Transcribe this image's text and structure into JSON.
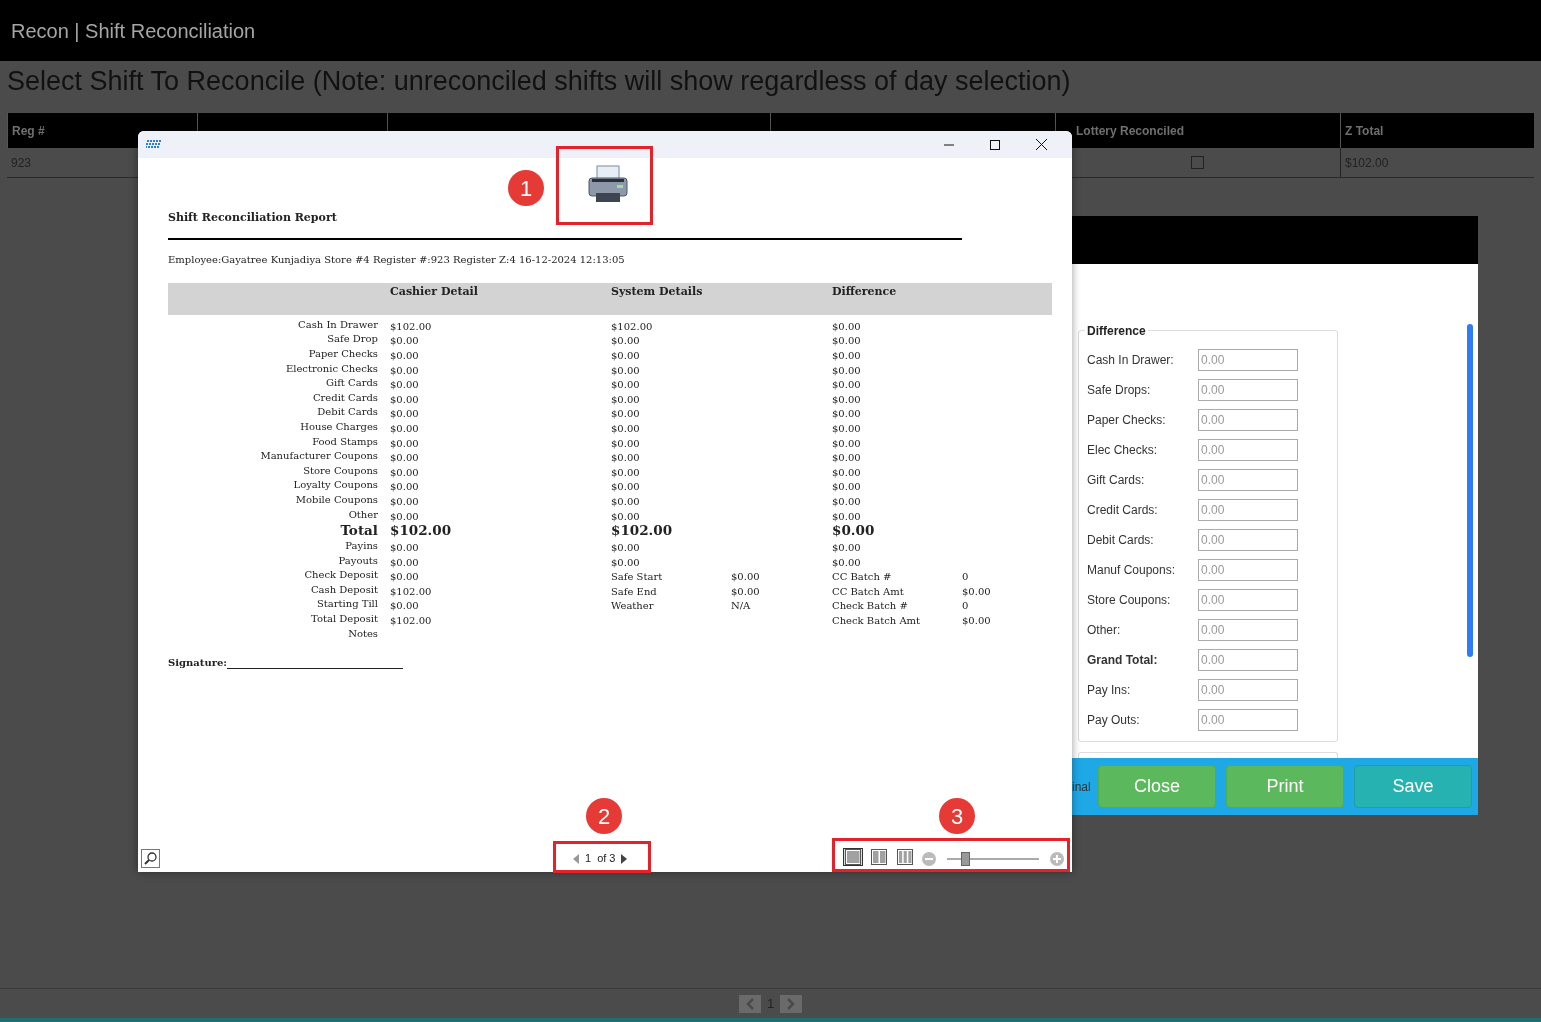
{
  "app": {
    "title": "Recon | Shift Reconciliation",
    "heading": "Select Shift To Reconcile (Note: unreconciled shifts will show regardless of day selection)"
  },
  "table": {
    "columns": [
      "Reg #",
      "Lottery Reconciled",
      "Z Total"
    ],
    "rows": [
      {
        "reg": "923",
        "lottery_reconciled": false,
        "z_total": "$102.00"
      }
    ]
  },
  "pagination": {
    "page": "1"
  },
  "edit_dialog": {
    "group_title": "Difference",
    "fields": [
      {
        "label": "Cash In Drawer:",
        "value": "0.00",
        "bold": false
      },
      {
        "label": "Safe Drops:",
        "value": "0.00",
        "bold": false
      },
      {
        "label": "Paper Checks:",
        "value": "0.00",
        "bold": false
      },
      {
        "label": "Elec Checks:",
        "value": "0.00",
        "bold": false
      },
      {
        "label": "Gift Cards:",
        "value": "0.00",
        "bold": false
      },
      {
        "label": "Credit Cards:",
        "value": "0.00",
        "bold": false
      },
      {
        "label": "Debit Cards:",
        "value": "0.00",
        "bold": false
      },
      {
        "label": "Manuf Coupons:",
        "value": "0.00",
        "bold": false
      },
      {
        "label": "Store Coupons:",
        "value": "0.00",
        "bold": false
      },
      {
        "label": "Other:",
        "value": "0.00",
        "bold": false
      },
      {
        "label": "Grand Total:",
        "value": "0.00",
        "bold": true
      },
      {
        "label": "Pay Ins:",
        "value": "0.00",
        "bold": false
      },
      {
        "label": "Pay Outs:",
        "value": "0.00",
        "bold": false
      }
    ],
    "footer_text": "inal",
    "buttons": [
      {
        "label": "Close",
        "kind": "green"
      },
      {
        "label": "Print",
        "kind": "green"
      },
      {
        "label": "Save",
        "kind": "teal"
      }
    ]
  },
  "report_window": {
    "annotations": [
      "1",
      "2",
      "3"
    ],
    "report": {
      "title": "Shift Reconciliation Report",
      "info": "Employee:Gayatree Kunjadiya Store #4 Register #:923 Register Z:4  16-12-2024 12:13:05",
      "columns": [
        "Cashier Detail",
        "System Details",
        "Difference"
      ],
      "rows": [
        {
          "label": "Cash In Drawer",
          "cashier": "$102.00",
          "system": "$102.00",
          "difference": "$0.00",
          "total": false
        },
        {
          "label": "Safe Drop",
          "cashier": "$0.00",
          "system": "$0.00",
          "difference": "$0.00",
          "total": false
        },
        {
          "label": "Paper Checks",
          "cashier": "$0.00",
          "system": "$0.00",
          "difference": "$0.00",
          "total": false
        },
        {
          "label": "Electronic Checks",
          "cashier": "$0.00",
          "system": "$0.00",
          "difference": "$0.00",
          "total": false
        },
        {
          "label": "Gift Cards",
          "cashier": "$0.00",
          "system": "$0.00",
          "difference": "$0.00",
          "total": false
        },
        {
          "label": "Credit Cards",
          "cashier": "$0.00",
          "system": "$0.00",
          "difference": "$0.00",
          "total": false
        },
        {
          "label": "Debit Cards",
          "cashier": "$0.00",
          "system": "$0.00",
          "difference": "$0.00",
          "total": false
        },
        {
          "label": "House Charges",
          "cashier": "$0.00",
          "system": "$0.00",
          "difference": "$0.00",
          "total": false
        },
        {
          "label": "Food Stamps",
          "cashier": "$0.00",
          "system": "$0.00",
          "difference": "$0.00",
          "total": false
        },
        {
          "label": "Manufacturer Coupons",
          "cashier": "$0.00",
          "system": "$0.00",
          "difference": "$0.00",
          "total": false
        },
        {
          "label": "Store Coupons",
          "cashier": "$0.00",
          "system": "$0.00",
          "difference": "$0.00",
          "total": false
        },
        {
          "label": "Loyalty Coupons",
          "cashier": "$0.00",
          "system": "$0.00",
          "difference": "$0.00",
          "total": false
        },
        {
          "label": "Mobile Coupons",
          "cashier": "$0.00",
          "system": "$0.00",
          "difference": "$0.00",
          "total": false
        },
        {
          "label": "Other",
          "cashier": "$0.00",
          "system": "$0.00",
          "difference": "$0.00",
          "total": false
        },
        {
          "label": "Total",
          "cashier": "$102.00",
          "system": "$102.00",
          "difference": "$0.00",
          "total": true
        },
        {
          "label": "Payins",
          "cashier": "$0.00",
          "system": "$0.00",
          "difference": "$0.00",
          "total": false
        },
        {
          "label": "Payouts",
          "cashier": "$0.00",
          "system": "$0.00",
          "difference": "$0.00",
          "total": false
        },
        {
          "label": "Check Deposit",
          "cashier": "$0.00",
          "system": "Safe Start",
          "system_value": "$0.00",
          "difference": "CC Batch #",
          "difference_value": "0",
          "total": false
        },
        {
          "label": "Cash Deposit",
          "cashier": "$102.00",
          "system": "Safe End",
          "system_value": "$0.00",
          "difference": "CC Batch Amt",
          "difference_value": "$0.00",
          "total": false
        },
        {
          "label": "Starting Till",
          "cashier": "$0.00",
          "system": "Weather",
          "system_value": "N/A",
          "difference": "Check Batch #",
          "difference_value": "0",
          "total": false
        },
        {
          "label": "Total Deposit",
          "cashier": "$102.00",
          "difference": "Check Batch Amt",
          "difference_value": "$0.00",
          "total": false
        },
        {
          "label": "Notes",
          "total": false
        }
      ],
      "signature_label": "Signature:"
    },
    "pager": {
      "page": "1",
      "of": "of 3"
    },
    "view_modes": [
      {
        "kind": "single",
        "selected": true
      },
      {
        "kind": "double",
        "selected": false
      },
      {
        "kind": "multi",
        "selected": false
      }
    ],
    "zoom": {
      "level": 0.2
    }
  }
}
